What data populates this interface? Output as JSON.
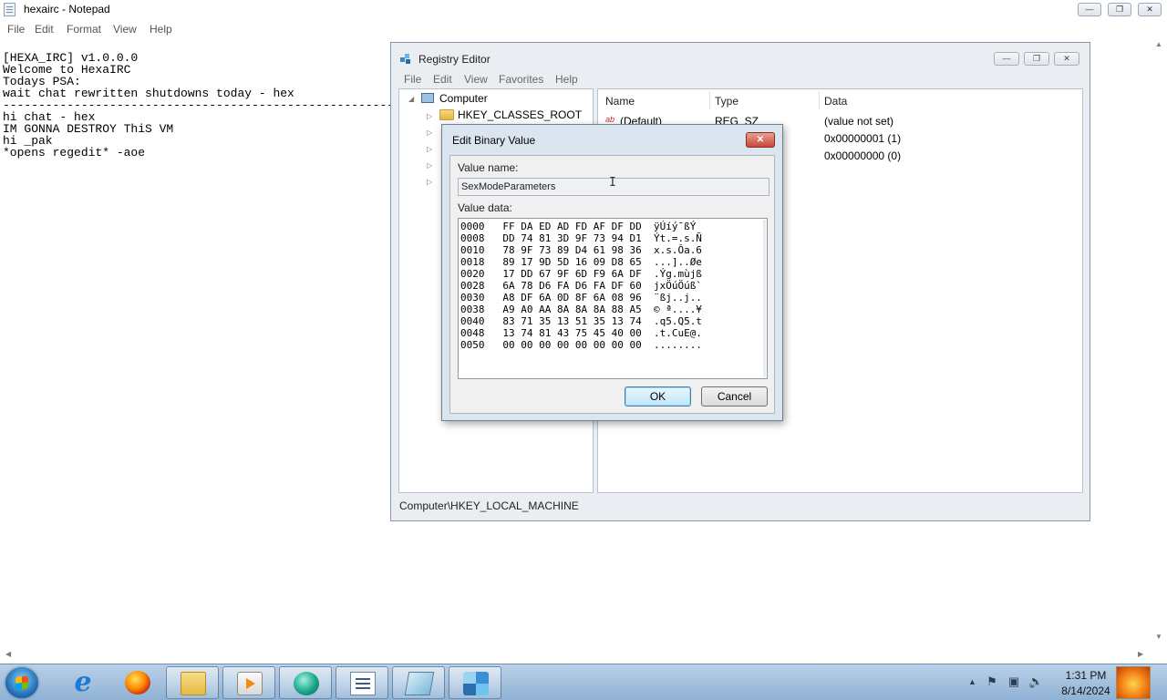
{
  "notepad": {
    "title": "hexairc - Notepad",
    "menu": [
      "File",
      "Edit",
      "Format",
      "View",
      "Help"
    ],
    "lines": [
      "[HEXA_IRC] v1.0.0.0",
      "Welcome to HexaIRC",
      "",
      "Todays PSA:",
      "wait chat rewritten shutdowns today - hex",
      "----------------------------------------------------------------------------------------------------------",
      "hi chat - hex",
      "IM GONNA DESTROY ThiS VM",
      "hi _pak",
      "*opens regedit* -aoe"
    ]
  },
  "regedit": {
    "title": "Registry Editor",
    "menu": [
      "File",
      "Edit",
      "View",
      "Favorites",
      "Help"
    ],
    "tree": {
      "root": "Computer",
      "items": [
        "HKEY_CLASSES_ROOT"
      ]
    },
    "columns": [
      "Name",
      "Type",
      "Data"
    ],
    "rows": [
      {
        "name": "(Default)",
        "type": "REG_SZ",
        "data": "(value not set)"
      },
      {
        "name": "",
        "type": "",
        "data": "0x00000001 (1)"
      },
      {
        "name": "",
        "type": "",
        "data": "0x00000000 (0)"
      }
    ],
    "status": "Computer\\HKEY_LOCAL_MACHINE"
  },
  "dialog": {
    "title": "Edit Binary Value",
    "value_name_label": "Value name:",
    "value_name": "SexModeParameters",
    "value_data_label": "Value data:",
    "hex_rows": [
      {
        "addr": "0000",
        "bytes": "FF DA ED AD FD AF DF DD",
        "ascii": "ÿÚí­ý¯ßÝ"
      },
      {
        "addr": "0008",
        "bytes": "DD 74 81 3D 9F 73 94 D1",
        "ascii": "Ýt.=.s.Ñ"
      },
      {
        "addr": "0010",
        "bytes": "78 9F 73 89 D4 61 98 36",
        "ascii": "x.s.Ôa.6"
      },
      {
        "addr": "0018",
        "bytes": "89 17 9D 5D 16 09 D8 65",
        "ascii": "...]..Øe"
      },
      {
        "addr": "0020",
        "bytes": "17 DD 67 9F 6D F9 6A DF",
        "ascii": ".Ýg.mùjß"
      },
      {
        "addr": "0028",
        "bytes": "6A 78 D6 FA D6 FA DF 60",
        "ascii": "jxÖúÖúß`"
      },
      {
        "addr": "0030",
        "bytes": "A8 DF 6A 0D 8F 6A 08 96",
        "ascii": "¨ßj..j.."
      },
      {
        "addr": "0038",
        "bytes": "A9 A0 AA 8A 8A 8A 88 A5",
        "ascii": "© ª....¥"
      },
      {
        "addr": "0040",
        "bytes": "83 71 35 13 51 35 13 74",
        "ascii": ".q5.Q5.t"
      },
      {
        "addr": "0048",
        "bytes": "13 74 81 43 75 45 40 00",
        "ascii": ".t.CuE@."
      },
      {
        "addr": "0050",
        "bytes": "00 00 00 00 00 00 00 00",
        "ascii": "........"
      }
    ],
    "ok_label": "OK",
    "cancel_label": "Cancel"
  },
  "taskbar": {
    "pinned": [
      "start-orb",
      "internet-explorer-icon",
      "firefox-icon",
      "explorer-icon",
      "media-player-icon",
      "browser-ball-icon",
      "notepad-icon",
      "regedit-icon",
      "app-cube-icon"
    ],
    "clock_time": "1:31 PM",
    "clock_date": "8/14/2024"
  }
}
